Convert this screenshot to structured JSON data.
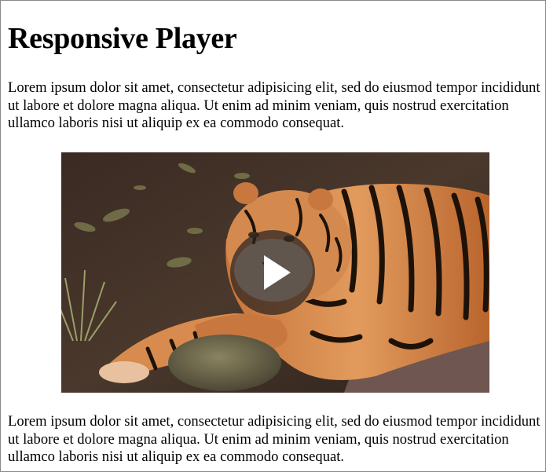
{
  "page": {
    "title": "Responsive Player",
    "paragraph_1": "Lorem ipsum dolor sit amet, consectetur adipisicing elit, sed do eiusmod tempor incididunt ut labore et dolore magna aliqua. Ut enim ad minim veniam, quis nostrud exercitation ullamco laboris nisi ut aliquip ex ea commodo consequat.",
    "paragraph_2": "Lorem ipsum dolor sit amet, consectetur adipisicing elit, sed do eiusmod tempor incididunt ut labore et dolore magna aliqua. Ut enim ad minim veniam, quis nostrud exercitation ullamco laboris nisi ut aliquip ex ea commodo consequat."
  },
  "player": {
    "poster_subject": "tiger lying on rocks",
    "play_icon": "play-icon"
  },
  "colors": {
    "play_overlay": "#2a2220",
    "play_triangle": "#ffffff"
  }
}
